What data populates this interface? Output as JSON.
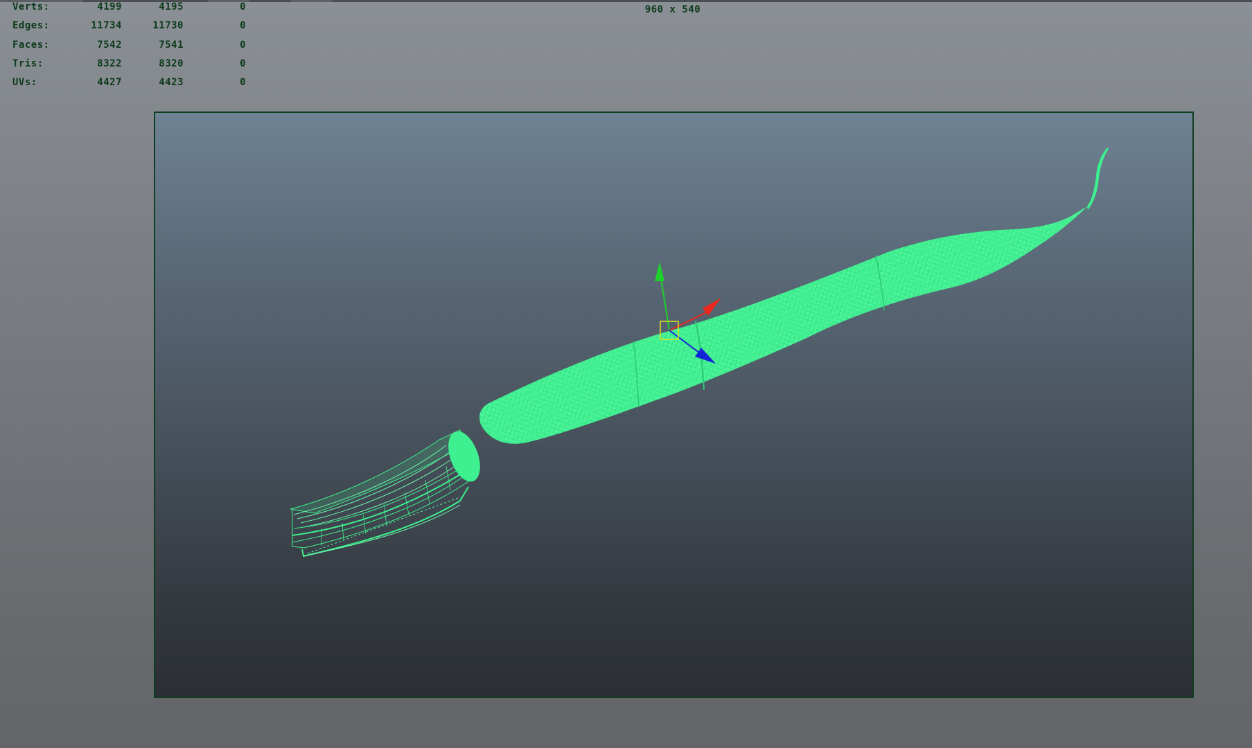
{
  "viewport_hud": {
    "poly_count": [
      {
        "label": "Verts:",
        "values": [
          "4199",
          "4195",
          "0"
        ]
      },
      {
        "label": "Edges:",
        "values": [
          "11734",
          "11730",
          "0"
        ]
      },
      {
        "label": "Faces:",
        "values": [
          "7542",
          "7541",
          "0"
        ]
      },
      {
        "label": "Tris:",
        "values": [
          "8322",
          "8320",
          "0"
        ]
      },
      {
        "label": "UVs:",
        "values": [
          "4427",
          "4423",
          "0"
        ]
      }
    ],
    "resolution_gate": "960 x 540"
  },
  "colors": {
    "wireframe": "#3ef08f",
    "gate_border": "#0f3d1f",
    "hud_text": "#0d3a1a",
    "manip_x": "#e8281c",
    "manip_y": "#1ed12a",
    "manip_z": "#1424d8",
    "manip_center": "#e6e020"
  },
  "viewport": {
    "object_icon": "squid-wireframe-mesh",
    "manipulator_icon": "move-tool-manipulator"
  }
}
